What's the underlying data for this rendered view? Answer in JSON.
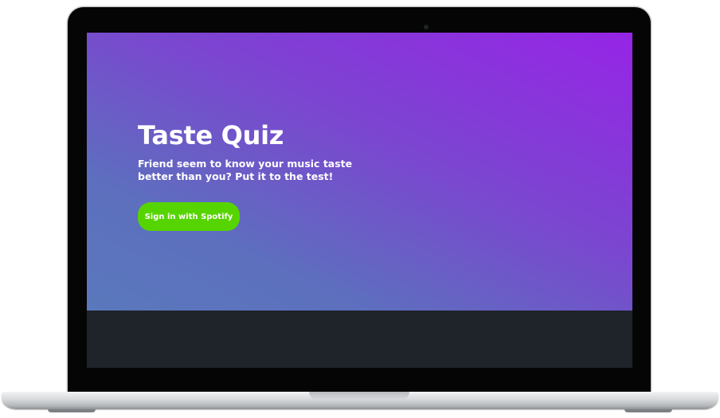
{
  "hero": {
    "title": "Taste Quiz",
    "subtitle": "Friend seem to know your music taste better than you? Put it to the test!",
    "signin_button_label": "Sign in with Spotify"
  },
  "colors": {
    "gradient_start": "#5a78bc",
    "gradient_end": "#9624e6",
    "button_green": "#56d400",
    "footer_dark": "#1f232a"
  }
}
